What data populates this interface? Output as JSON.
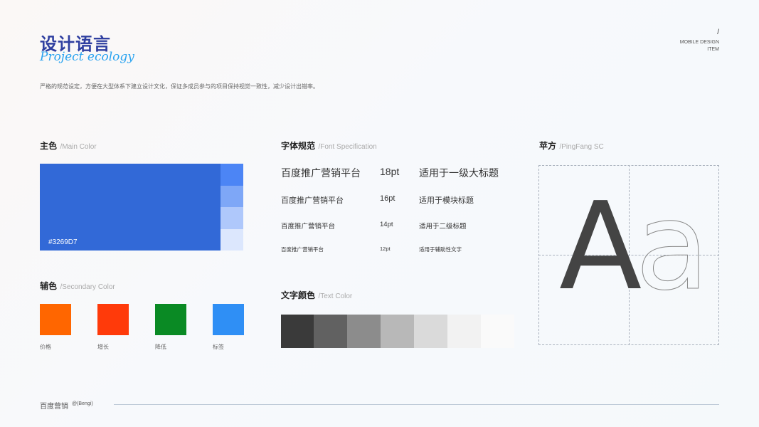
{
  "header": {
    "title_cn": "设计语言",
    "title_en": "Project ecology",
    "description": "严格的规范设定，方便在大型体系下建立设计文化，保证多成员参与的项目保持视觉一致性，减少设计出错率。",
    "top_right_slash": "/",
    "top_right_line1": "MOBILE DESIGN",
    "top_right_line2": "ITEM"
  },
  "main_color": {
    "title": "主色",
    "subtitle": "/Main Color",
    "hex": "#3269D7",
    "base": "#3269D7",
    "shades": [
      "#4C85F5",
      "#7EA7F7",
      "#AFC8FB",
      "#DCE7FD"
    ]
  },
  "secondary_color": {
    "title": "辅色",
    "subtitle": "/Secondary Color",
    "items": [
      {
        "label": "价格",
        "color": "#FF6600"
      },
      {
        "label": "增长",
        "color": "#FF3A0A"
      },
      {
        "label": "降低",
        "color": "#0A8A24"
      },
      {
        "label": "标签",
        "color": "#2F8FF5"
      }
    ]
  },
  "font_spec": {
    "title": "字体规范",
    "subtitle": "/Font Specification",
    "rows": [
      {
        "sample": "百度推广营销平台",
        "size": "18pt",
        "usage": "适用于一级大标题"
      },
      {
        "sample": "百度推广营销平台",
        "size": "16pt",
        "usage": "适用于模块标题"
      },
      {
        "sample": "百度推广营销平台",
        "size": "14pt",
        "usage": "适用于二级标题"
      },
      {
        "sample": "百度推广营销平台",
        "size": "12pt",
        "usage": "适用于辅助性文字"
      }
    ]
  },
  "text_color": {
    "title": "文字颜色",
    "subtitle": "/Text Color",
    "swatches": [
      "#3A3A3A",
      "#616161",
      "#8C8C8C",
      "#B8B8B8",
      "#DADADA",
      "#F2F2F2",
      "#FAFAFA"
    ]
  },
  "font_family": {
    "title": "苹方",
    "subtitle": "/PingFang SC",
    "glyph_upper": "A",
    "glyph_lower": "a"
  },
  "footer": {
    "brand": "百度营销",
    "handle": "@(Bengi)"
  }
}
